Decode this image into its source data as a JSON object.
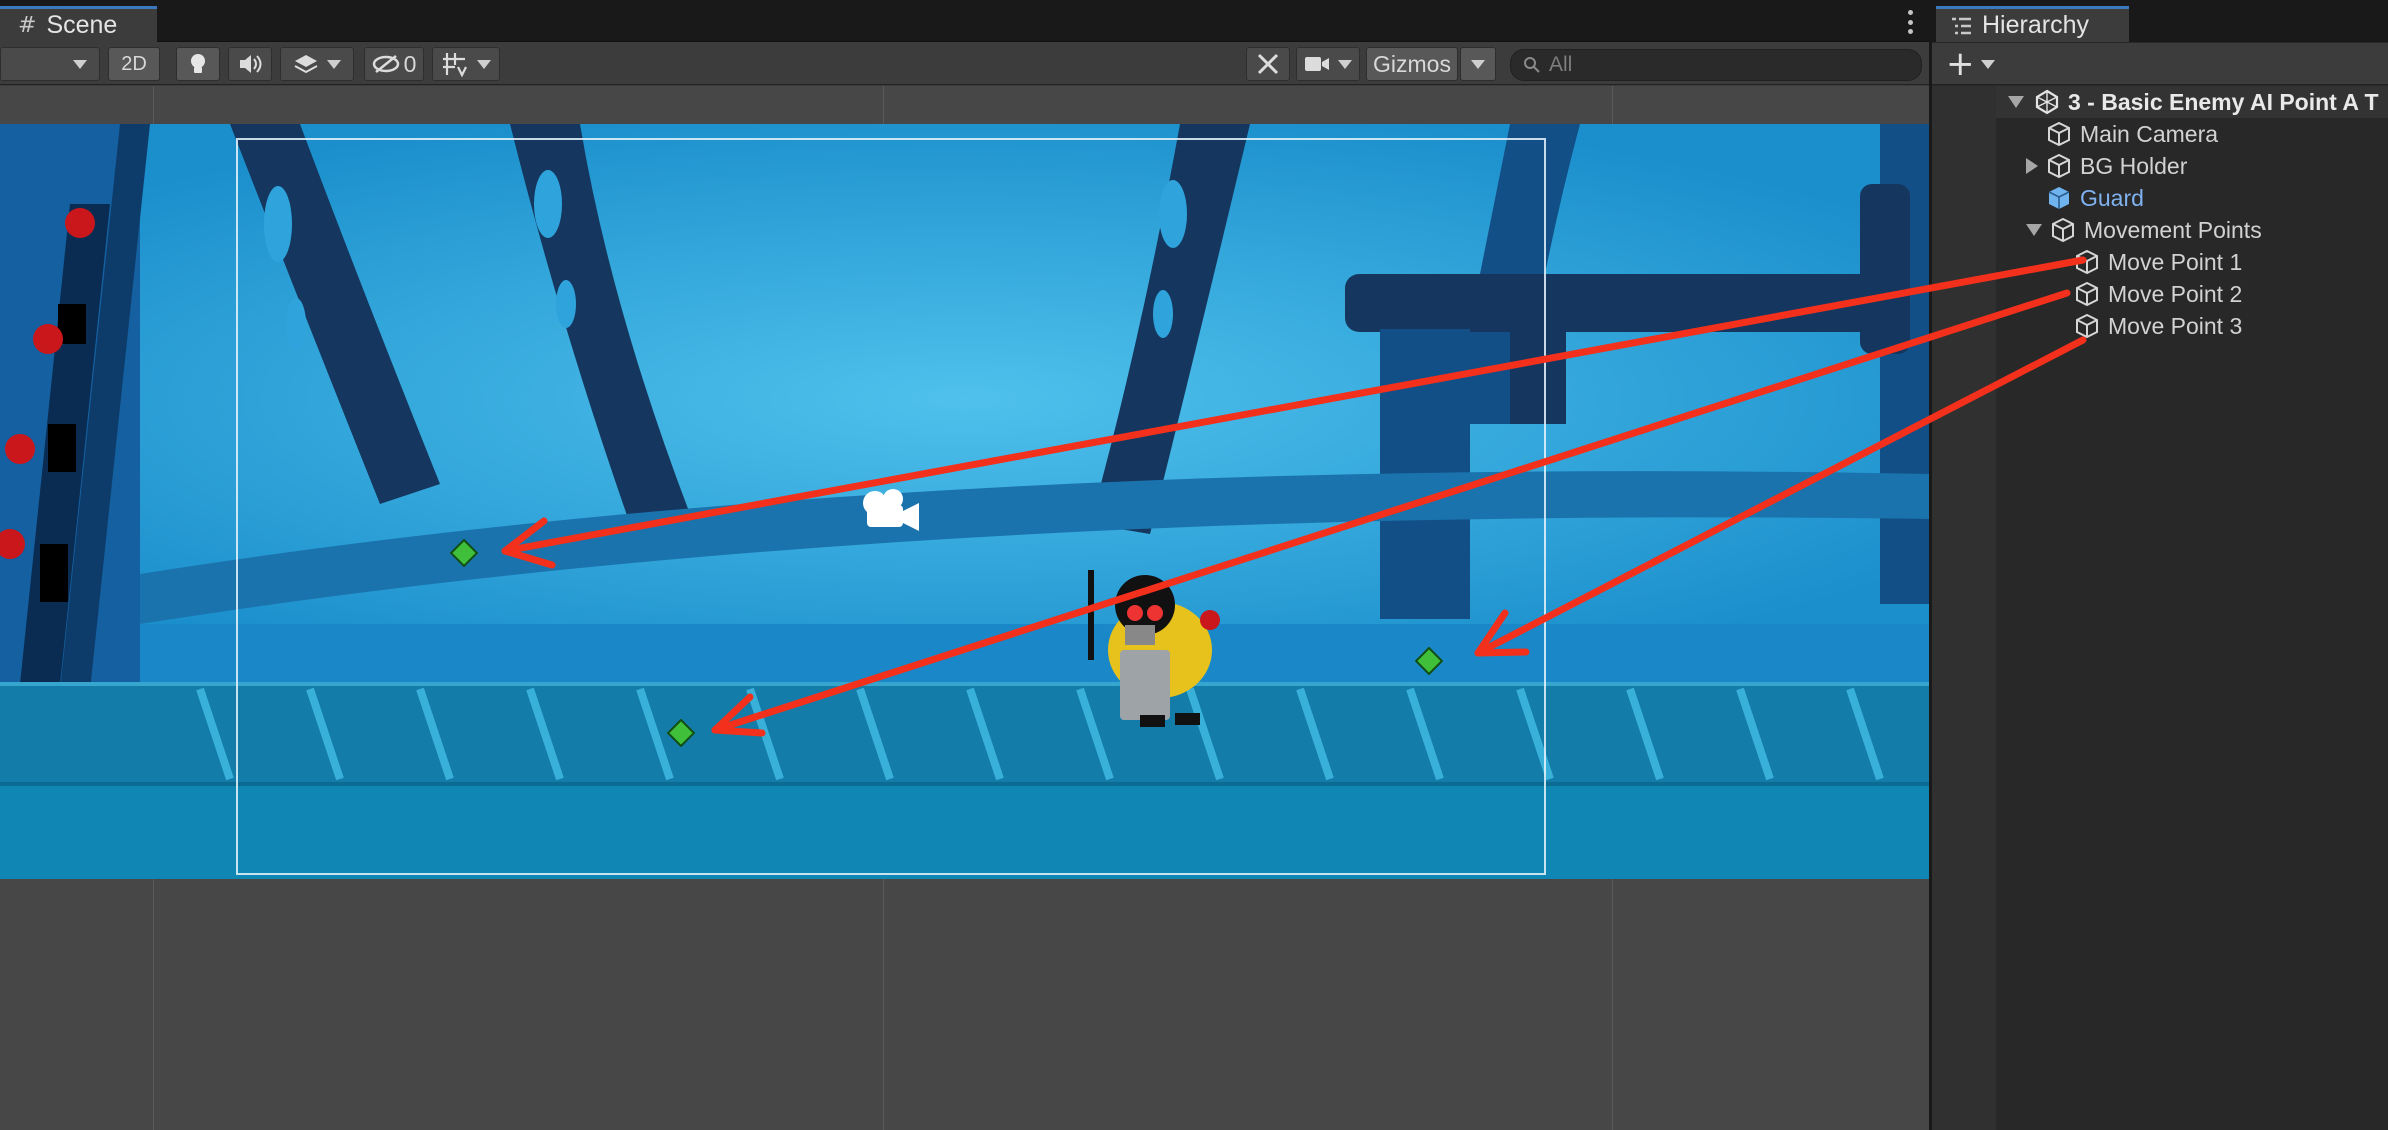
{
  "scene_panel": {
    "tab_label": "Scene",
    "toolbar": {
      "mode_2d": "2D",
      "hidden_count": "0",
      "gizmos_label": "Gizmos",
      "search_placeholder": "All"
    }
  },
  "hierarchy": {
    "tab_label": "Hierarchy",
    "add_label": "+",
    "items": [
      {
        "label": "3 - Basic Enemy AI Point A T",
        "kind": "scene",
        "expanded": true
      },
      {
        "label": "Main Camera",
        "kind": "gameobject"
      },
      {
        "label": "BG Holder",
        "kind": "gameobject",
        "expanded": false
      },
      {
        "label": "Guard",
        "kind": "prefab"
      },
      {
        "label": "Movement Points",
        "kind": "gameobject",
        "expanded": true
      },
      {
        "label": "Move Point 1",
        "kind": "gameobject"
      },
      {
        "label": "Move Point 2",
        "kind": "gameobject"
      },
      {
        "label": "Move Point 3",
        "kind": "gameobject"
      }
    ]
  },
  "colors": {
    "accent_tab": "#3a79bb",
    "arrow_red": "#f2301c",
    "prefab_blue": "#7fb2f0",
    "scene_sky": "#1e9ad6",
    "move_point_green": "#3fbf3a"
  }
}
